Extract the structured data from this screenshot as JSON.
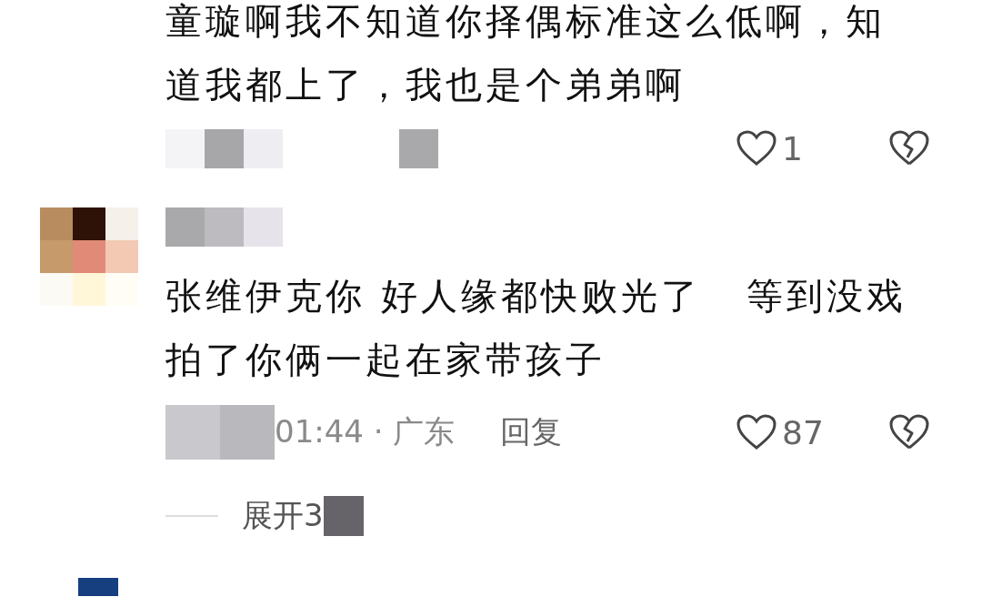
{
  "comments": [
    {
      "text": "童璇啊我不知道你择偶标准这么低啊，知道我都上了，我也是个弟弟啊",
      "likes": "1",
      "liked": false
    },
    {
      "text": "张维伊克你 好人缘都快败光了   等到没戏拍了你俩一起在家带孩子",
      "meta": "01:44 · 广东",
      "reply": "回复",
      "likes": "87",
      "liked": false,
      "expand": "展开3"
    }
  ]
}
